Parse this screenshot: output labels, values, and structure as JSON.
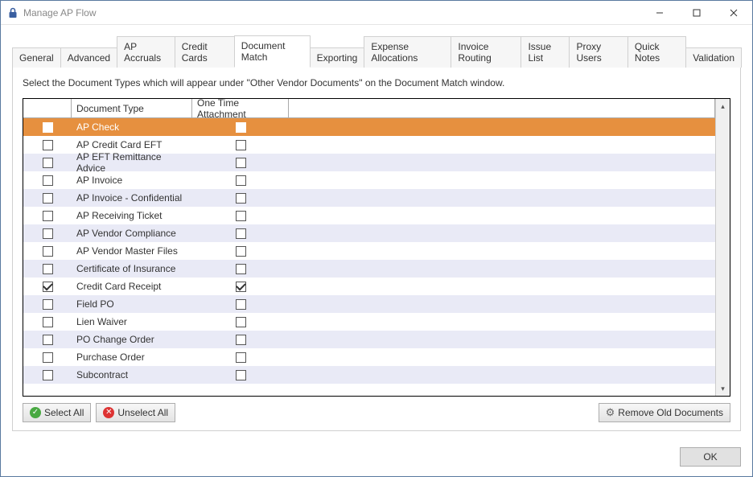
{
  "window": {
    "title": "Manage AP Flow"
  },
  "tabs": [
    {
      "label": "General",
      "active": false
    },
    {
      "label": "Advanced",
      "active": false
    },
    {
      "label": "AP Accruals",
      "active": false
    },
    {
      "label": "Credit Cards",
      "active": false
    },
    {
      "label": "Document Match",
      "active": true
    },
    {
      "label": "Exporting",
      "active": false
    },
    {
      "label": "Expense Allocations",
      "active": false
    },
    {
      "label": "Invoice Routing",
      "active": false
    },
    {
      "label": "Issue List",
      "active": false
    },
    {
      "label": "Proxy Users",
      "active": false
    },
    {
      "label": "Quick Notes",
      "active": false
    },
    {
      "label": "Validation",
      "active": false
    }
  ],
  "instructions": "Select the Document Types which will appear under \"Other Vendor Documents\" on the Document Match window.",
  "columns": {
    "doc_type": "Document Type",
    "one_time": "One Time Attachment"
  },
  "rows": [
    {
      "name": "AP Check",
      "checked": false,
      "one_time": false,
      "selected": true
    },
    {
      "name": "AP Credit Card EFT",
      "checked": false,
      "one_time": false,
      "selected": false
    },
    {
      "name": "AP EFT Remittance Advice",
      "checked": false,
      "one_time": false,
      "selected": false
    },
    {
      "name": "AP Invoice",
      "checked": false,
      "one_time": false,
      "selected": false
    },
    {
      "name": "AP Invoice - Confidential",
      "checked": false,
      "one_time": false,
      "selected": false
    },
    {
      "name": "AP Receiving Ticket",
      "checked": false,
      "one_time": false,
      "selected": false
    },
    {
      "name": "AP Vendor Compliance",
      "checked": false,
      "one_time": false,
      "selected": false
    },
    {
      "name": "AP Vendor Master Files",
      "checked": false,
      "one_time": false,
      "selected": false
    },
    {
      "name": "Certificate of Insurance",
      "checked": false,
      "one_time": false,
      "selected": false
    },
    {
      "name": "Credit Card Receipt",
      "checked": true,
      "one_time": true,
      "selected": false
    },
    {
      "name": "Field PO",
      "checked": false,
      "one_time": false,
      "selected": false
    },
    {
      "name": "Lien Waiver",
      "checked": false,
      "one_time": false,
      "selected": false
    },
    {
      "name": "PO Change Order",
      "checked": false,
      "one_time": false,
      "selected": false
    },
    {
      "name": "Purchase Order",
      "checked": false,
      "one_time": false,
      "selected": false
    },
    {
      "name": "Subcontract",
      "checked": false,
      "one_time": false,
      "selected": false
    }
  ],
  "buttons": {
    "select_all": "Select All",
    "unselect_all": "Unselect All",
    "remove_old": "Remove Old Documents",
    "ok": "OK"
  }
}
